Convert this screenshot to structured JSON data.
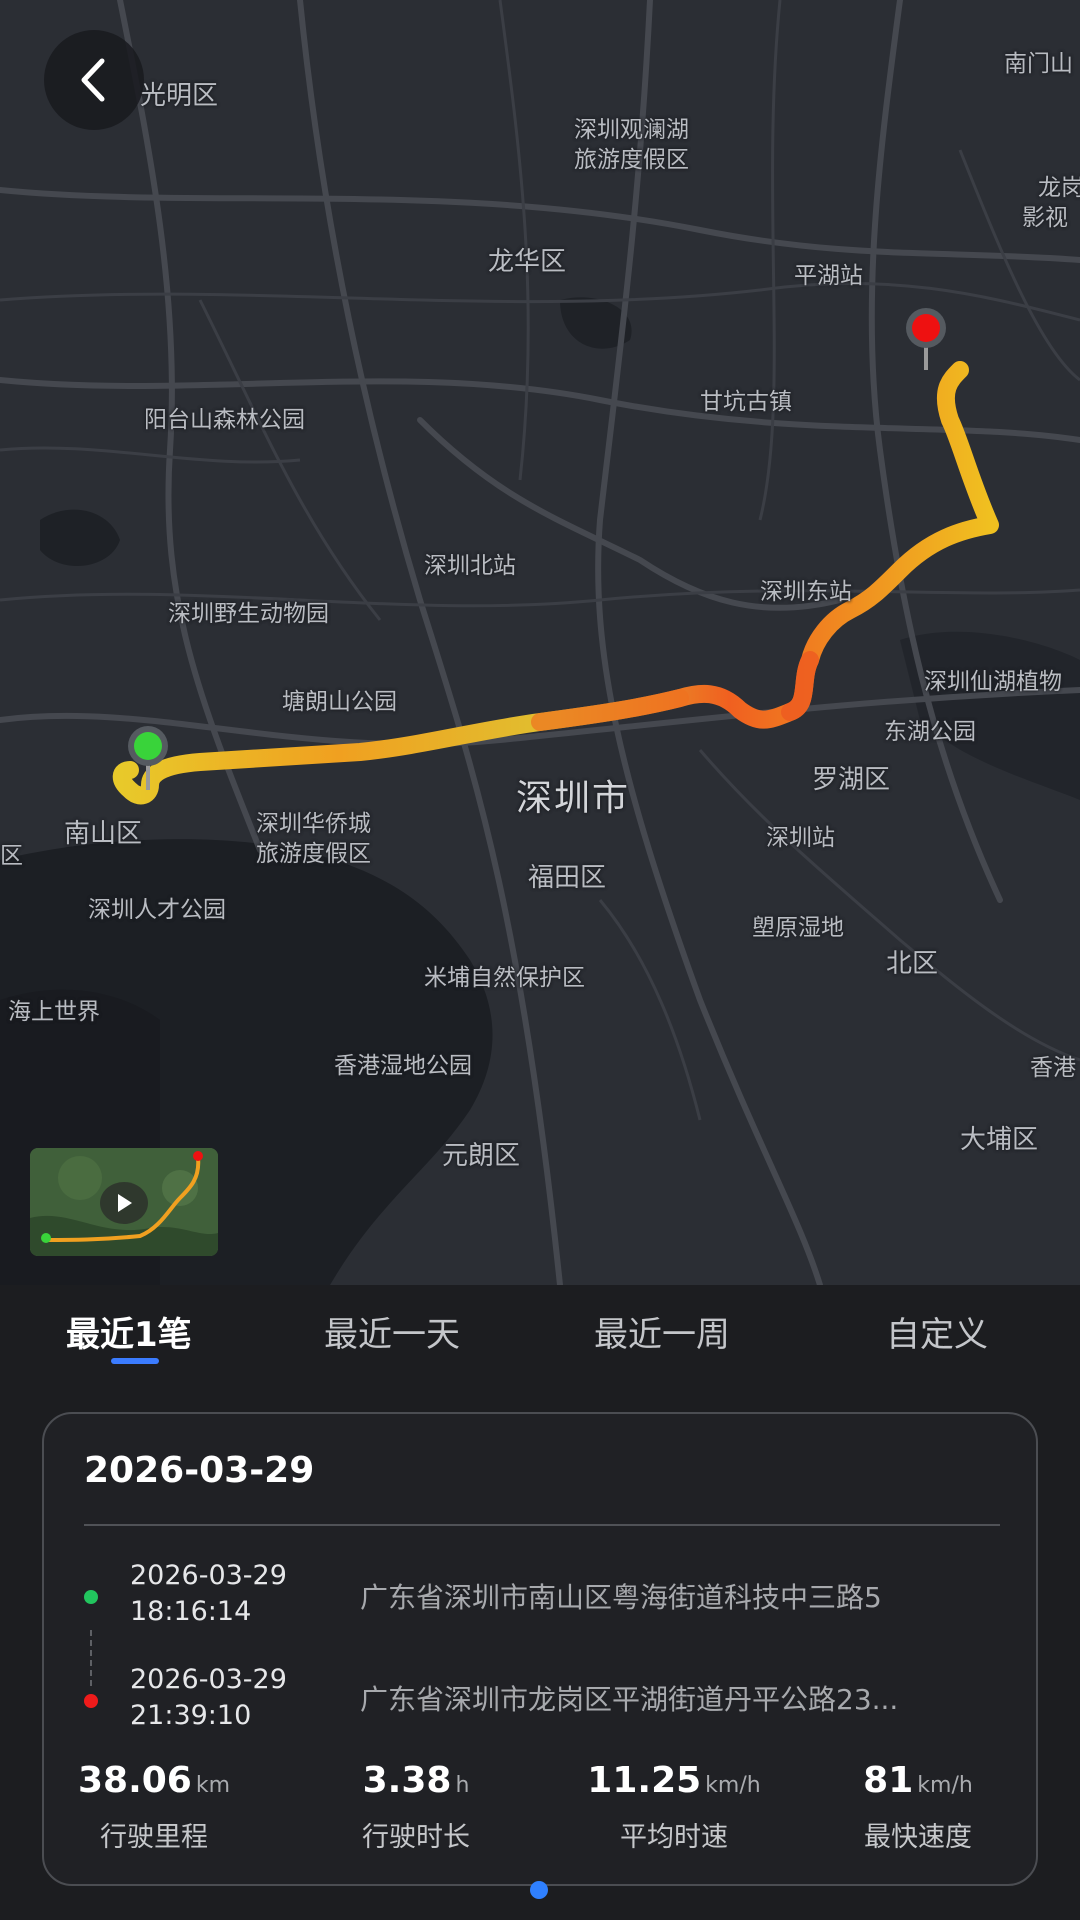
{
  "map": {
    "labels": {
      "l1": "光明区",
      "l2": "深圳观澜湖",
      "l3": "旅游度假区",
      "l4": "南门山",
      "l5": "龙岗",
      "l6": "影视",
      "l7": "龙华区",
      "l8": "平湖站",
      "l9": "甘坑古镇",
      "l10": "阳台山森林公园",
      "l11": "深圳北站",
      "l12": "深圳东站",
      "l13": "深圳野生动物园",
      "l14": "深圳仙湖植物",
      "l15": "塘朗山公园",
      "l16": "东湖公园",
      "l17": "深圳市",
      "l18": "罗湖区",
      "l19": "南山区",
      "l20": "深圳华侨城",
      "l21": "旅游度假区",
      "l22": "深圳站",
      "l23": "福田区",
      "l24": "深圳人才公园",
      "l25": "塱原湿地",
      "l26": "北区",
      "l27": "米埔自然保护区",
      "l28": "海上世界",
      "l29": "香港湿地公园",
      "l30": "香港",
      "l31": "元朗区",
      "l32": "大埔区",
      "l33": "区"
    },
    "start_marker_color": "#39d33a",
    "end_marker_color": "#ee1111"
  },
  "back_icon": "chevron-left-icon",
  "thumbnail_icon": "play-icon",
  "tabs": [
    {
      "label": "最近1笔",
      "active": true
    },
    {
      "label": "最近一天",
      "active": false
    },
    {
      "label": "最近一周",
      "active": false
    },
    {
      "label": "自定义",
      "active": false
    }
  ],
  "card": {
    "date": "2026-03-29",
    "start": {
      "date": "2026-03-29",
      "time": "18:16:14",
      "address": "广东省深圳市南山区粤海街道科技中三路5",
      "color": "#22c55e"
    },
    "end": {
      "date": "2026-03-29",
      "time": "21:39:10",
      "address": "广东省深圳市龙岗区平湖街道丹平公路23...",
      "color": "#ef1b1b"
    },
    "stats": [
      {
        "value": "38.06",
        "unit": "km",
        "label": "行驶里程"
      },
      {
        "value": "3.38",
        "unit": "h",
        "label": "行驶时长"
      },
      {
        "value": "11.25",
        "unit": "km/h",
        "label": "平均时速"
      },
      {
        "value": "81",
        "unit": "km/h",
        "label": "最快速度"
      }
    ]
  },
  "accent_color": "#3b7cff"
}
